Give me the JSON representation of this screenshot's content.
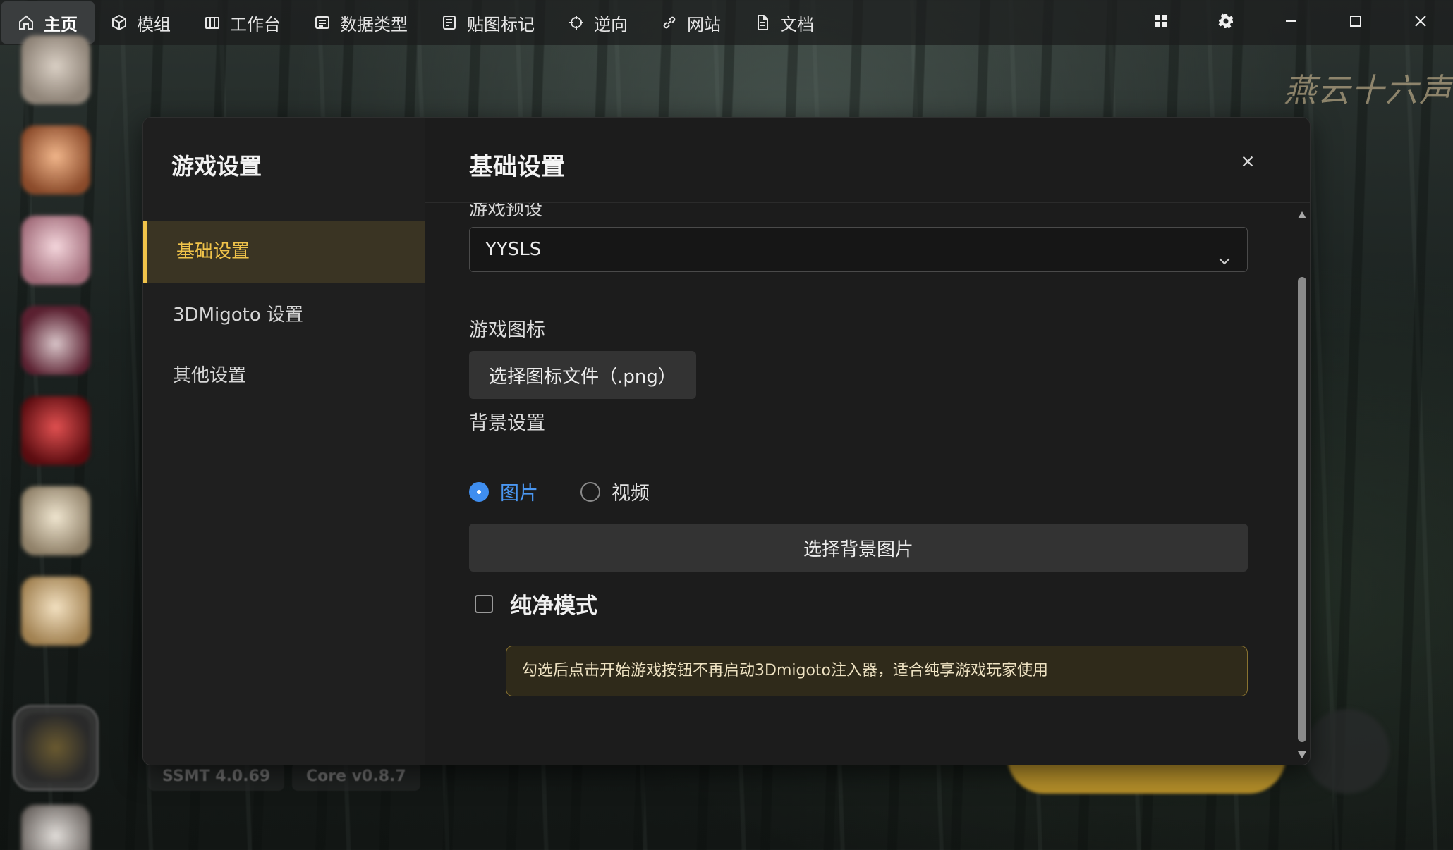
{
  "nav": {
    "items": [
      {
        "label": "主页",
        "icon": "home-icon"
      },
      {
        "label": "模组",
        "icon": "cube-icon"
      },
      {
        "label": "工作台",
        "icon": "workbench-icon"
      },
      {
        "label": "数据类型",
        "icon": "data-type-icon"
      },
      {
        "label": "贴图标记",
        "icon": "texture-mark-icon"
      },
      {
        "label": "逆向",
        "icon": "crosshair-icon"
      },
      {
        "label": "网站",
        "icon": "link-icon"
      },
      {
        "label": "文档",
        "icon": "document-icon"
      }
    ],
    "active_index": 0
  },
  "window_controls": [
    "grid-icon",
    "settings-icon",
    "minimize-icon",
    "maximize-icon",
    "close-icon"
  ],
  "background": {
    "logo_text": "燕云十六声",
    "versions": [
      "SSMT 4.0.69",
      "Core v0.8.7"
    ]
  },
  "dialog": {
    "sidebar_title": "游戏设置",
    "sidebar_items": [
      {
        "label": "基础设置",
        "active": true
      },
      {
        "label": "3DMigoto 设置",
        "active": false
      },
      {
        "label": "其他设置",
        "active": false
      }
    ],
    "main_title": "基础设置",
    "preset_label_cut": "游戏预设",
    "preset_value": "YYSLS",
    "icon_label": "游戏图标",
    "icon_button": "选择图标文件（.png）",
    "bg_label": "背景设置",
    "bg_options": [
      {
        "label": "图片",
        "checked": true
      },
      {
        "label": "视频",
        "checked": false
      }
    ],
    "bg_button": "选择背景图片",
    "pure_mode_label": "纯净模式",
    "pure_mode_checked": false,
    "pure_mode_notice": "勾选后点击开始游戏按钮不再启动3Dmigoto注入器，适合纯享游戏玩家使用"
  },
  "colors": {
    "accent_gold": "#f0c34a",
    "radio_blue": "#3f8ef0",
    "start_button": "#c9a233"
  }
}
